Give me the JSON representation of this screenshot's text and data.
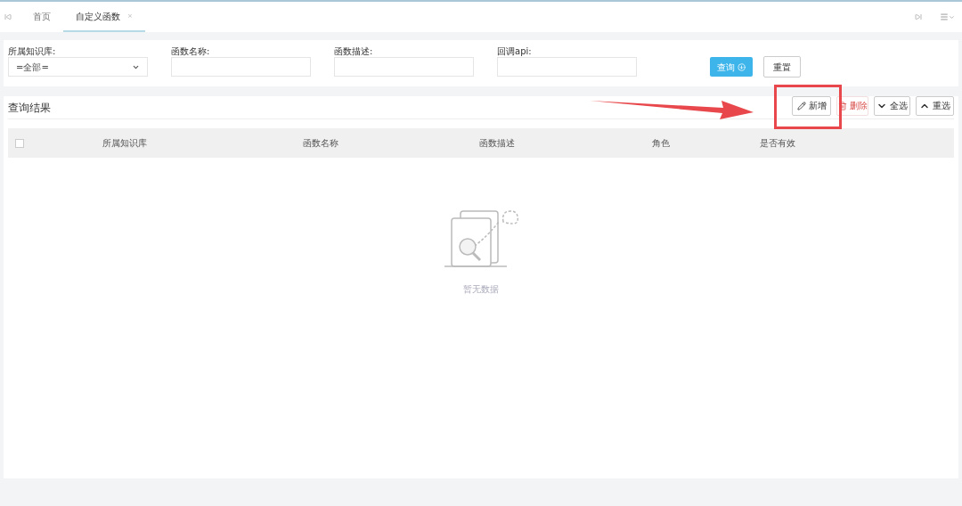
{
  "tabs": [
    {
      "label": "首页",
      "selected": false
    },
    {
      "label": "自定义函数",
      "selected": true,
      "close": "×"
    }
  ],
  "filters": [
    {
      "kind": "select",
      "label": "所属知识库:",
      "value": "=全部="
    },
    {
      "kind": "text",
      "label": "函数名称:"
    },
    {
      "kind": "text",
      "label": "函数描述:"
    },
    {
      "kind": "text",
      "label": "回调api:"
    }
  ],
  "filter_buttons": [
    {
      "kind": "primary",
      "label": "查询"
    },
    {
      "kind": "plain",
      "label": "重置"
    }
  ],
  "results": {
    "title": "查询结果",
    "actions": [
      {
        "kind": "add",
        "label": "新增"
      },
      {
        "kind": "delete",
        "label": "删除"
      },
      {
        "kind": "select_all",
        "label": "全选"
      },
      {
        "kind": "reselect",
        "label": "重选"
      }
    ],
    "table": {
      "header_checked": false,
      "columns": [
        "所属知识库",
        "函数名称",
        "函数描述",
        "角色",
        "是否有效"
      ]
    },
    "empty_text": "暂无数据"
  }
}
